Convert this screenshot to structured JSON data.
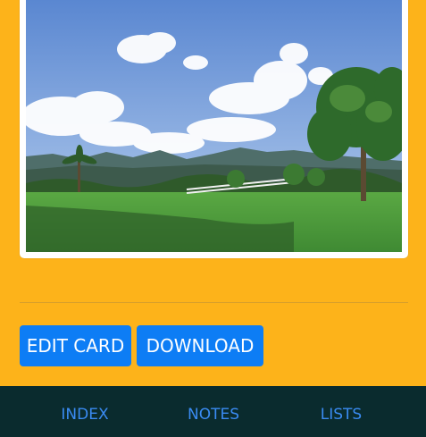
{
  "photo": {
    "description_icon": "landscape-photo",
    "sky_color": "#6f97d6",
    "grass_color": "#4e9a3d"
  },
  "actions": {
    "edit_label": "EDIT CARD",
    "download_label": "DOWNLOAD"
  },
  "nav": {
    "items": [
      {
        "label": "INDEX"
      },
      {
        "label": "NOTES"
      },
      {
        "label": "LISTS"
      }
    ]
  },
  "colors": {
    "background": "#FDB31A",
    "button": "#0d7df5",
    "nav_background": "#0a2b2e",
    "nav_text": "#3a8bf2"
  }
}
